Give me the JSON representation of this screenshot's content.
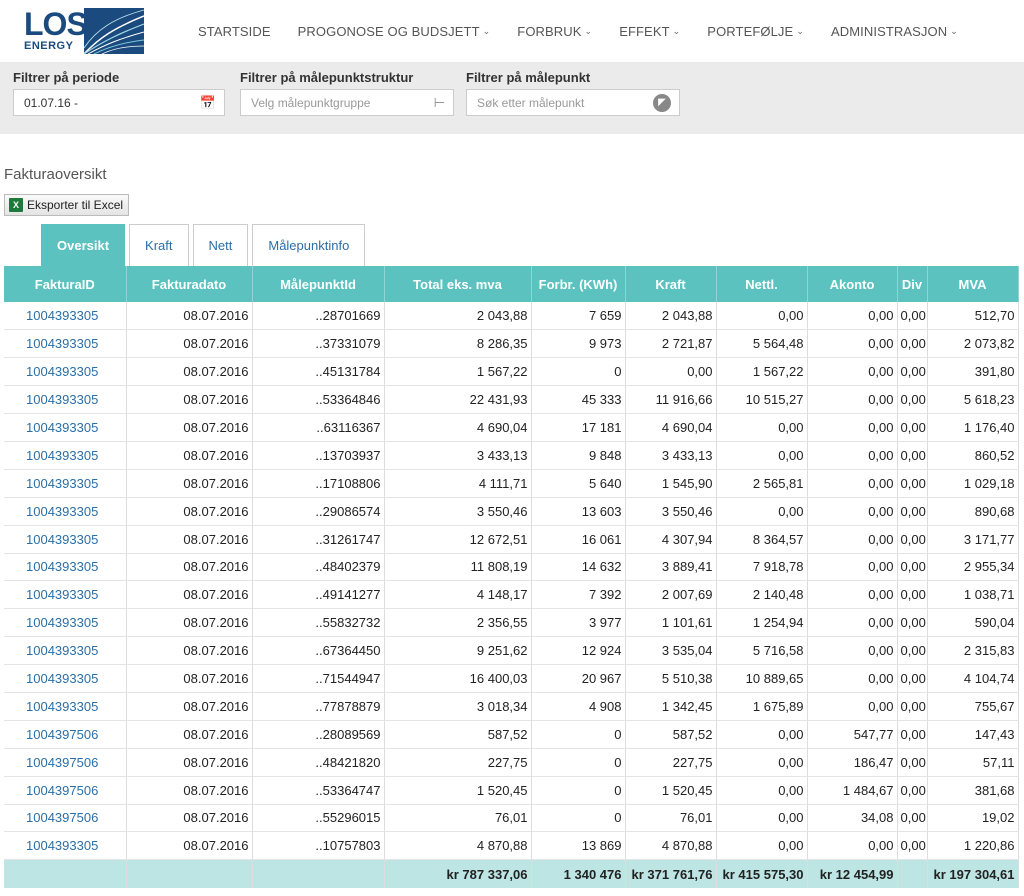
{
  "logo": {
    "line1": "LOS",
    "line2": "ENERGY"
  },
  "nav": [
    {
      "label": "STARTSIDE",
      "dropdown": false
    },
    {
      "label": "PROGONOSE OG BUDSJETT",
      "dropdown": true
    },
    {
      "label": "FORBRUK",
      "dropdown": true
    },
    {
      "label": "EFFEKT",
      "dropdown": true
    },
    {
      "label": "PORTEFØLJE",
      "dropdown": true
    },
    {
      "label": "ADMINISTRASJON",
      "dropdown": true
    }
  ],
  "filters": {
    "period": {
      "label": "Filtrer på periode",
      "value": "01.07.16 -"
    },
    "structure": {
      "label": "Filtrer på målepunktstruktur",
      "placeholder": "Velg målepunktgruppe"
    },
    "point": {
      "label": "Filtrer på målepunkt",
      "placeholder": "Søk etter målepunkt"
    }
  },
  "page_title": "Fakturaoversikt",
  "export_label": "Eksporter til Excel",
  "tabs": [
    "Oversikt",
    "Kraft",
    "Nett",
    "Målepunktinfo"
  ],
  "active_tab": "Oversikt",
  "table": {
    "columns": [
      "FakturaID",
      "Fakturadato",
      "MålepunktId",
      "Total eks. mva",
      "Forbr. (KWh)",
      "Kraft",
      "Nettl.",
      "Akonto",
      "Div",
      "MVA"
    ],
    "rows": [
      [
        "1004393305",
        "08.07.2016",
        "..28701669",
        "2 043,88",
        "7 659",
        "2 043,88",
        "0,00",
        "0,00",
        "0,00",
        "512,70"
      ],
      [
        "1004393305",
        "08.07.2016",
        "..37331079",
        "8 286,35",
        "9 973",
        "2 721,87",
        "5 564,48",
        "0,00",
        "0,00",
        "2 073,82"
      ],
      [
        "1004393305",
        "08.07.2016",
        "..45131784",
        "1 567,22",
        "0",
        "0,00",
        "1 567,22",
        "0,00",
        "0,00",
        "391,80"
      ],
      [
        "1004393305",
        "08.07.2016",
        "..53364846",
        "22 431,93",
        "45 333",
        "11 916,66",
        "10 515,27",
        "0,00",
        "0,00",
        "5 618,23"
      ],
      [
        "1004393305",
        "08.07.2016",
        "..63116367",
        "4 690,04",
        "17 181",
        "4 690,04",
        "0,00",
        "0,00",
        "0,00",
        "1 176,40"
      ],
      [
        "1004393305",
        "08.07.2016",
        "..13703937",
        "3 433,13",
        "9 848",
        "3 433,13",
        "0,00",
        "0,00",
        "0,00",
        "860,52"
      ],
      [
        "1004393305",
        "08.07.2016",
        "..17108806",
        "4 111,71",
        "5 640",
        "1 545,90",
        "2 565,81",
        "0,00",
        "0,00",
        "1 029,18"
      ],
      [
        "1004393305",
        "08.07.2016",
        "..29086574",
        "3 550,46",
        "13 603",
        "3 550,46",
        "0,00",
        "0,00",
        "0,00",
        "890,68"
      ],
      [
        "1004393305",
        "08.07.2016",
        "..31261747",
        "12 672,51",
        "16 061",
        "4 307,94",
        "8 364,57",
        "0,00",
        "0,00",
        "3 171,77"
      ],
      [
        "1004393305",
        "08.07.2016",
        "..48402379",
        "11 808,19",
        "14 632",
        "3 889,41",
        "7 918,78",
        "0,00",
        "0,00",
        "2 955,34"
      ],
      [
        "1004393305",
        "08.07.2016",
        "..49141277",
        "4 148,17",
        "7 392",
        "2 007,69",
        "2 140,48",
        "0,00",
        "0,00",
        "1 038,71"
      ],
      [
        "1004393305",
        "08.07.2016",
        "..55832732",
        "2 356,55",
        "3 977",
        "1 101,61",
        "1 254,94",
        "0,00",
        "0,00",
        "590,04"
      ],
      [
        "1004393305",
        "08.07.2016",
        "..67364450",
        "9 251,62",
        "12 924",
        "3 535,04",
        "5 716,58",
        "0,00",
        "0,00",
        "2 315,83"
      ],
      [
        "1004393305",
        "08.07.2016",
        "..71544947",
        "16 400,03",
        "20 967",
        "5 510,38",
        "10 889,65",
        "0,00",
        "0,00",
        "4 104,74"
      ],
      [
        "1004393305",
        "08.07.2016",
        "..77878879",
        "3 018,34",
        "4 908",
        "1 342,45",
        "1 675,89",
        "0,00",
        "0,00",
        "755,67"
      ],
      [
        "1004397506",
        "08.07.2016",
        "..28089569",
        "587,52",
        "0",
        "587,52",
        "0,00",
        "547,77",
        "0,00",
        "147,43"
      ],
      [
        "1004397506",
        "08.07.2016",
        "..48421820",
        "227,75",
        "0",
        "227,75",
        "0,00",
        "186,47",
        "0,00",
        "57,11"
      ],
      [
        "1004397506",
        "08.07.2016",
        "..53364747",
        "1 520,45",
        "0",
        "1 520,45",
        "0,00",
        "1 484,67",
        "0,00",
        "381,68"
      ],
      [
        "1004397506",
        "08.07.2016",
        "..55296015",
        "76,01",
        "0",
        "76,01",
        "0,00",
        "34,08",
        "0,00",
        "19,02"
      ],
      [
        "1004393305",
        "08.07.2016",
        "..10757803",
        "4 870,88",
        "13 869",
        "4 870,88",
        "0,00",
        "0,00",
        "0,00",
        "1 220,86"
      ]
    ],
    "totals": [
      "",
      "",
      "",
      "kr 787 337,06",
      "1 340 476",
      "kr 371 761,76",
      "kr 415 575,30",
      "kr 12 454,99",
      "",
      "kr 197 304,61"
    ]
  }
}
